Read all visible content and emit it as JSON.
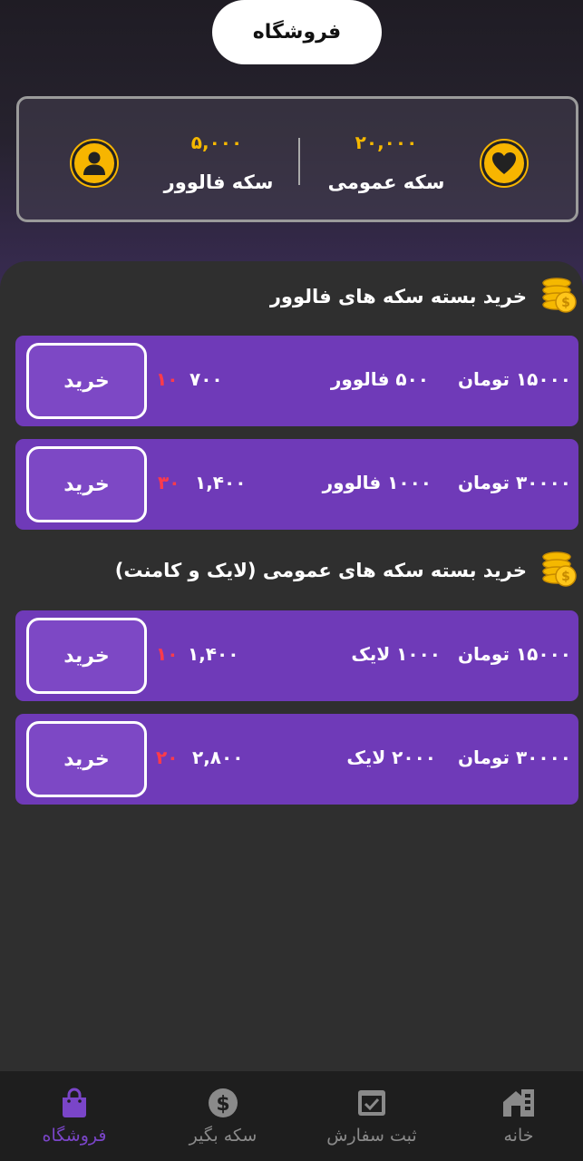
{
  "header": {
    "title": "فروشگاه"
  },
  "balances": {
    "general": {
      "amount": "۲۰,۰۰۰",
      "label": "سکه عمومی",
      "icon": "heart-icon"
    },
    "follower": {
      "amount": "۵,۰۰۰",
      "label": "سکه فالوور",
      "icon": "user-icon"
    }
  },
  "sections": [
    {
      "title": "خرید بسته سکه های فالوور",
      "packs": [
        {
          "price": "۱۵۰۰۰ تومان",
          "qty": "۵۰۰ فالوور",
          "amount": "۷۰۰",
          "discount": "۱۰",
          "buy": "خرید"
        },
        {
          "price": "۳۰۰۰۰ تومان",
          "qty": "۱۰۰۰ فالوور",
          "amount": "۱,۴۰۰",
          "discount": "۳۰",
          "buy": "خرید"
        }
      ]
    },
    {
      "title": "خرید بسته سکه های عمومی (لایک و کامنت)",
      "packs": [
        {
          "price": "۱۵۰۰۰ تومان",
          "qty": "۱۰۰۰ لایک",
          "amount": "۱,۴۰۰",
          "discount": "۱۰",
          "buy": "خرید"
        },
        {
          "price": "۳۰۰۰۰ تومان",
          "qty": "۲۰۰۰ لایک",
          "amount": "۲,۸۰۰",
          "discount": "۲۰",
          "buy": "خرید"
        }
      ]
    }
  ],
  "nav": [
    {
      "label": "فروشگاه",
      "icon": "shopping-bag-icon",
      "active": true
    },
    {
      "label": "سکه بگیر",
      "icon": "dollar-coin-icon",
      "active": false
    },
    {
      "label": "ثبت سفارش",
      "icon": "checkbox-icon",
      "active": false
    },
    {
      "label": "خانه",
      "icon": "home-icon",
      "active": false
    }
  ],
  "colors": {
    "accent": "#6f3ab8",
    "coin": "#f5b800",
    "discount": "#ff3b4a",
    "background": "#2f2f2f"
  }
}
